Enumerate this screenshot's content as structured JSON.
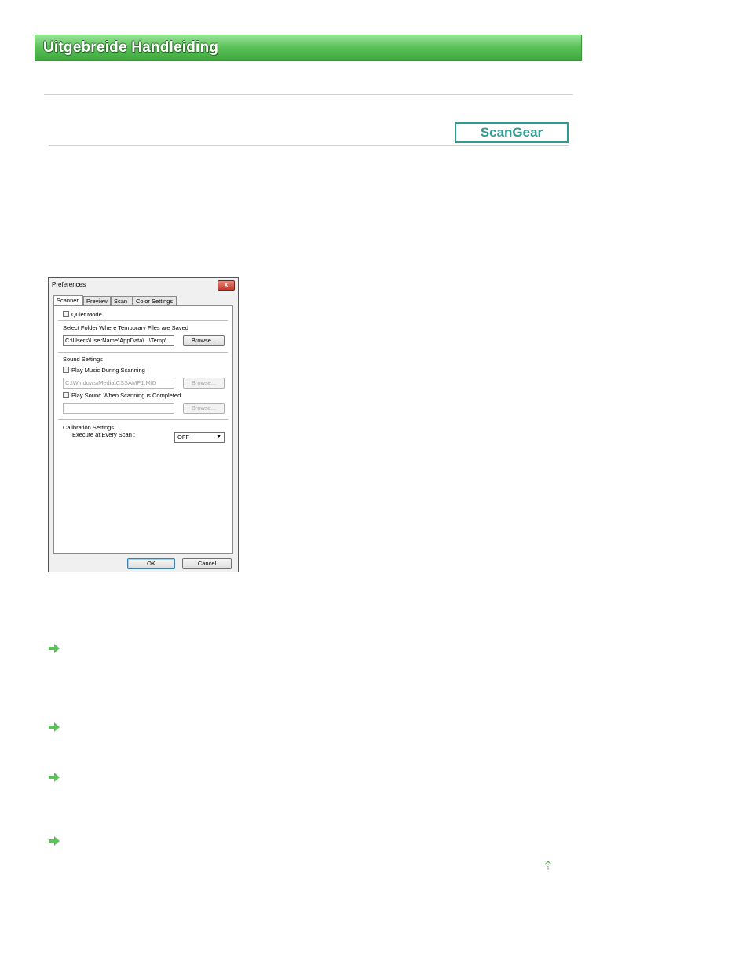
{
  "header": {
    "title": "Uitgebreide Handleiding"
  },
  "badge": {
    "label": "ScanGear"
  },
  "dialog": {
    "title": "Preferences",
    "close_label": "x",
    "tabs": [
      "Scanner",
      "Preview",
      "Scan",
      "Color Settings"
    ],
    "quiet_mode_label": "Quiet Mode",
    "temp_folder_label": "Select Folder Where Temporary Files are Saved",
    "temp_folder_value": "C:\\Users\\UserName\\AppData\\...\\Temp\\",
    "browse_label": "Browse...",
    "sound_settings_label": "Sound Settings",
    "play_music_label": "Play Music During Scanning",
    "music_path_value": "C:\\Windows\\Media\\CSSAMP1.MID",
    "play_sound_label": "Play Sound When Scanning is Completed",
    "sound_path_value": "",
    "calibration_label": "Calibration Settings",
    "execute_label": "Execute at Every Scan :",
    "execute_value": "OFF",
    "ok_label": "OK",
    "cancel_label": "Cancel"
  },
  "colors": {
    "banner": "#5cc25a",
    "badge": "#2e9c92",
    "arrow": "#5cc25a"
  },
  "icons": {
    "list_arrow": "right-arrow-icon",
    "page_top": "up-arrow-icon"
  }
}
